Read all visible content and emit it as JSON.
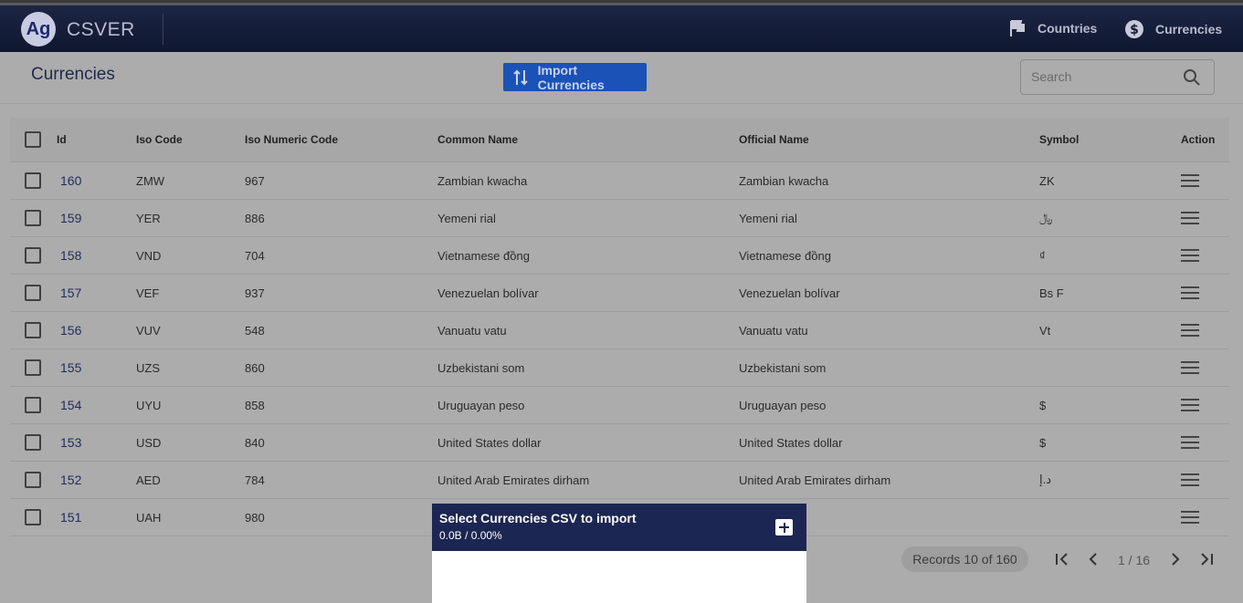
{
  "app": {
    "logo_text": "Ag",
    "name": "CSVER"
  },
  "nav": {
    "countries": "Countries",
    "currencies": "Currencies"
  },
  "page": {
    "title": "Currencies",
    "import_button": "Import Currencies",
    "search_placeholder": "Search"
  },
  "table": {
    "columns": [
      "Id",
      "Iso Code",
      "Iso Numeric Code",
      "Common Name",
      "Official Name",
      "Symbol",
      "Action"
    ],
    "rows": [
      {
        "id": "160",
        "iso": "ZMW",
        "num": "967",
        "common": "Zambian kwacha",
        "official": "Zambian kwacha",
        "symbol": "ZK"
      },
      {
        "id": "159",
        "iso": "YER",
        "num": "886",
        "common": "Yemeni rial",
        "official": "Yemeni rial",
        "symbol": "﷼"
      },
      {
        "id": "158",
        "iso": "VND",
        "num": "704",
        "common": "Vietnamese đồng",
        "official": "Vietnamese đồng",
        "symbol": "₫"
      },
      {
        "id": "157",
        "iso": "VEF",
        "num": "937",
        "common": "Venezuelan bolívar",
        "official": "Venezuelan bolívar",
        "symbol": "Bs F"
      },
      {
        "id": "156",
        "iso": "VUV",
        "num": "548",
        "common": "Vanuatu vatu",
        "official": "Vanuatu vatu",
        "symbol": "Vt"
      },
      {
        "id": "155",
        "iso": "UZS",
        "num": "860",
        "common": "Uzbekistani som",
        "official": "Uzbekistani som",
        "symbol": ""
      },
      {
        "id": "154",
        "iso": "UYU",
        "num": "858",
        "common": "Uruguayan peso",
        "official": "Uruguayan peso",
        "symbol": "$"
      },
      {
        "id": "153",
        "iso": "USD",
        "num": "840",
        "common": "United States dollar",
        "official": "United States dollar",
        "symbol": "$"
      },
      {
        "id": "152",
        "iso": "AED",
        "num": "784",
        "common": "United Arab Emirates dirham",
        "official": "United Arab Emirates dirham",
        "symbol": "د.إ"
      },
      {
        "id": "151",
        "iso": "UAH",
        "num": "980",
        "common": "",
        "official": "vnia",
        "symbol": ""
      }
    ]
  },
  "pagination": {
    "records": "Records 10 of 160",
    "page_info": "1 / 16"
  },
  "dialog": {
    "title": "Select Currencies CSV to import",
    "progress": "0.0B / 0.00%"
  }
}
